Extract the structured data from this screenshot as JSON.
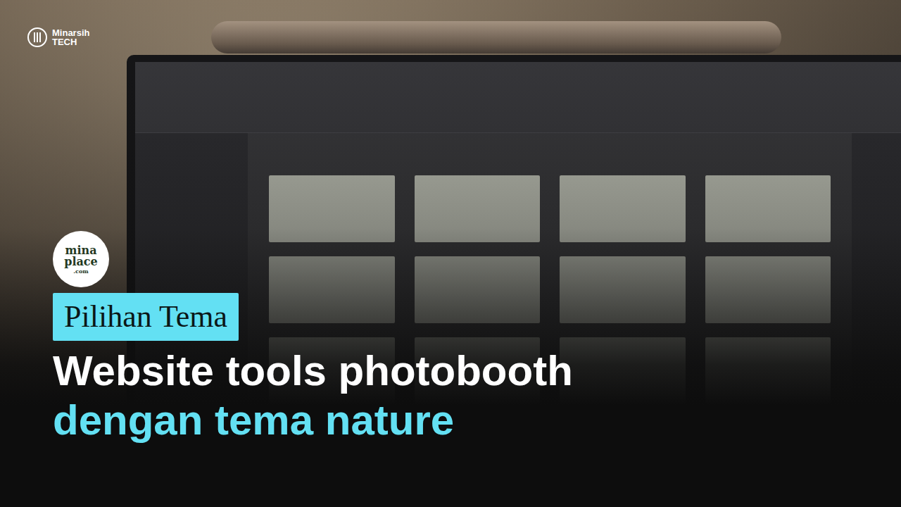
{
  "brand": {
    "name": "Minarsih",
    "sub": "TECH"
  },
  "partner_logo": {
    "lines": [
      "mina",
      "place",
      ".com"
    ]
  },
  "tag": "Pilihan Tema",
  "headline": {
    "line1": "Website tools photobooth",
    "line2": "dengan tema nature"
  }
}
